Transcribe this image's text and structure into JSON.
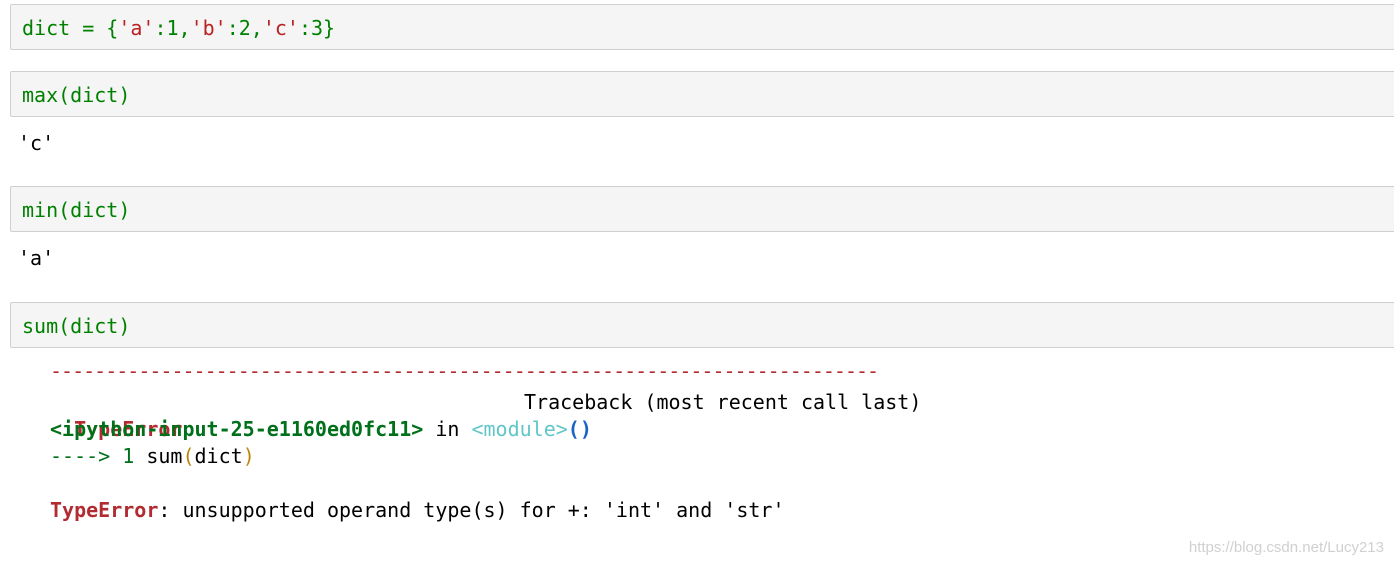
{
  "cells": [
    {
      "code": {
        "prefix": "dict = {",
        "k1": "'a'",
        "v1": ":1,",
        "k2": "'b'",
        "v2": ":2,",
        "k3": "'c'",
        "v3": ":3}"
      }
    },
    {
      "code": "max(dict)",
      "output": "'c'"
    },
    {
      "code": "min(dict)",
      "output": "'a'"
    },
    {
      "code": "sum(dict)"
    }
  ],
  "traceback": {
    "separator": "---------------------------------------------------------------------------",
    "error_name": "TypeError",
    "header_right": "Traceback (most recent call last)",
    "input_name": "<ipython-input-25-e1160ed0fc11>",
    "in_word": " in ",
    "module": "<module>",
    "parens": "()",
    "arrow": "----> 1",
    "call_name": " sum",
    "paren_open": "(",
    "call_arg": "dict",
    "paren_close": ")",
    "final_error_name": "TypeError",
    "final_message": ": unsupported operand type(s) for +: 'int' and 'str'"
  },
  "watermark": "https://blog.csdn.net/Lucy213"
}
